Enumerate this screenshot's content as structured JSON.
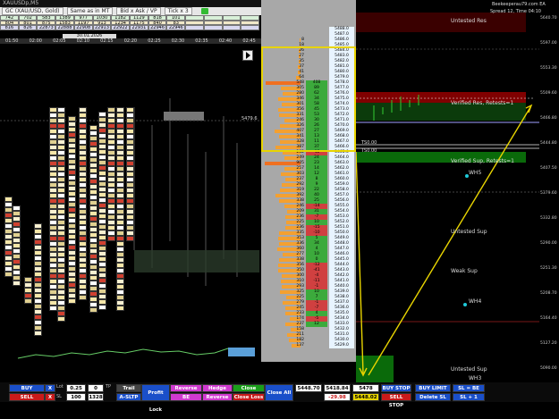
{
  "window": {
    "title": "XAUUSDp,M5",
    "top_right_title": "Beekeeperau79.com EA",
    "spread_label": "Spread 12, Time 04:10"
  },
  "toolbar": {
    "symbol": "GC (XAU/USD, Gold)",
    "mt_mode": "Same as in MT",
    "mode": "Bid x Ask / VP",
    "tick": "Tick x 3"
  },
  "stat_grid": [
    [
      "742",
      "702",
      "583",
      "1389",
      "977",
      "1030",
      "1182",
      "1129",
      "818",
      "101",
      "",
      "",
      "",
      ""
    ],
    [
      "804",
      "801",
      "875",
      "1583",
      "1197",
      "913",
      "1234",
      "1175",
      "840",
      "83",
      "",
      "",
      "",
      ""
    ],
    [
      "816",
      "826",
      "22873",
      "22888",
      "22908",
      "22913",
      "22922",
      "22931",
      "22946",
      "22946",
      "",
      "",
      "",
      ""
    ]
  ],
  "date_label": "30.01.2026",
  "time_row": [
    "01:50",
    "02:00",
    "02:05",
    "02:10",
    "02:15",
    "02:20",
    "02:25",
    "02:30",
    "02:35",
    "02:40",
    "02:45"
  ],
  "chart_price_marker": "5479.6",
  "volume_profile": [
    {
      "vol": "",
      "delta": "",
      "price": "5488.0"
    },
    {
      "vol": "",
      "delta": "",
      "price": "5487.0"
    },
    {
      "vol": "8",
      "delta": "",
      "price": "5486.0"
    },
    {
      "vol": "18",
      "delta": "",
      "price": "5485.0"
    },
    {
      "vol": "26",
      "delta": "",
      "price": "5484.0"
    },
    {
      "vol": "27",
      "delta": "",
      "price": "5483.0"
    },
    {
      "vol": "35",
      "delta": "",
      "price": "5482.0"
    },
    {
      "vol": "37",
      "delta": "",
      "price": "5481.0"
    },
    {
      "vol": "41",
      "delta": "",
      "price": "5480.0"
    },
    {
      "vol": "64",
      "delta": "",
      "price": "5479.0"
    },
    {
      "vol": "548",
      "delta": "408",
      "price": "5478.0"
    },
    {
      "vol": "305",
      "delta": "89",
      "price": "5477.0"
    },
    {
      "vol": "280",
      "delta": "62",
      "price": "5476.0"
    },
    {
      "vol": "346",
      "delta": "34",
      "price": "5475.0"
    },
    {
      "vol": "301",
      "delta": "58",
      "price": "5474.0"
    },
    {
      "vol": "356",
      "delta": "45",
      "price": "5473.0"
    },
    {
      "vol": "331",
      "delta": "53",
      "price": "5472.0"
    },
    {
      "vol": "246",
      "delta": "30",
      "price": "5471.0"
    },
    {
      "vol": "326",
      "delta": "26",
      "price": "5470.0"
    },
    {
      "vol": "407",
      "delta": "27",
      "price": "5469.0"
    },
    {
      "vol": "341",
      "delta": "13",
      "price": "5468.0"
    },
    {
      "vol": "328",
      "delta": "11",
      "price": "5467.0"
    },
    {
      "vol": "387",
      "delta": "37",
      "price": "5466.0"
    },
    {
      "vol": "282",
      "delta": "-12",
      "price": "5465.0"
    },
    {
      "vol": "249",
      "delta": "24",
      "price": "5464.0"
    },
    {
      "vol": "905",
      "delta": "23",
      "price": "5463.0"
    },
    {
      "vol": "257",
      "delta": "14",
      "price": "5462.0"
    },
    {
      "vol": "303",
      "delta": "12",
      "price": "5461.0"
    },
    {
      "vol": "237",
      "delta": "8",
      "price": "5460.0"
    },
    {
      "vol": "292",
      "delta": "9",
      "price": "5459.0"
    },
    {
      "vol": "319",
      "delta": "22",
      "price": "5458.0"
    },
    {
      "vol": "392",
      "delta": "40",
      "price": "5457.0"
    },
    {
      "vol": "338",
      "delta": "25",
      "price": "5456.0"
    },
    {
      "vol": "246",
      "delta": "-14",
      "price": "5455.0"
    },
    {
      "vol": "209",
      "delta": "31",
      "price": "5454.0"
    },
    {
      "vol": "236",
      "delta": "-7",
      "price": "5453.0"
    },
    {
      "vol": "225",
      "delta": "10",
      "price": "5452.0"
    },
    {
      "vol": "236",
      "delta": "-15",
      "price": "5451.0"
    },
    {
      "vol": "335",
      "delta": "-10",
      "price": "5450.0"
    },
    {
      "vol": "353",
      "delta": "5",
      "price": "5449.0"
    },
    {
      "vol": "336",
      "delta": "34",
      "price": "5448.0"
    },
    {
      "vol": "360",
      "delta": "4",
      "price": "5447.0"
    },
    {
      "vol": "277",
      "delta": "10",
      "price": "5446.0"
    },
    {
      "vol": "338",
      "delta": "0",
      "price": "5445.0"
    },
    {
      "vol": "356",
      "delta": "-12",
      "price": "5444.0"
    },
    {
      "vol": "350",
      "delta": "-41",
      "price": "5443.0"
    },
    {
      "vol": "300",
      "delta": "-4",
      "price": "5442.0"
    },
    {
      "vol": "310",
      "delta": "-11",
      "price": "5441.0"
    },
    {
      "vol": "293",
      "delta": "-1",
      "price": "5440.0"
    },
    {
      "vol": "325",
      "delta": "10",
      "price": "5439.0"
    },
    {
      "vol": "225",
      "delta": "7",
      "price": "5438.0"
    },
    {
      "vol": "279",
      "delta": "-1",
      "price": "5437.0"
    },
    {
      "vol": "245",
      "delta": "-7",
      "price": "5436.0"
    },
    {
      "vol": "233",
      "delta": "4",
      "price": "5435.0"
    },
    {
      "vol": "174",
      "delta": "-5",
      "price": "5434.0"
    },
    {
      "vol": "237",
      "delta": "12",
      "price": "5433.0"
    },
    {
      "vol": "158",
      "delta": "",
      "price": "5432.0"
    },
    {
      "vol": "211",
      "delta": "",
      "price": "5431.0"
    },
    {
      "vol": "182",
      "delta": "",
      "price": "5430.0"
    },
    {
      "vol": "137",
      "delta": "",
      "price": "5429.0"
    }
  ],
  "right_labels": {
    "untested_res": "Untested Res",
    "verified_res": "Verified Res, Retests=1",
    "verified_sup": "Verified Sup, Retests=1",
    "untested_sup": "Untested Sup",
    "weak_sup": "Weak Sup",
    "untested_sup2": "Untested Sup",
    "wh5": "WH5",
    "wh4": "WH4",
    "wh3": "WH3",
    "level_a": "TS0.00",
    "level_b": "TS0.00"
  },
  "price_axis": [
    "5640.70",
    "5597.00",
    "5553.30",
    "5509.60",
    "5466.80",
    "5444.80",
    "5407.50",
    "5379.60",
    "5332.80",
    "5290.00",
    "5251.30",
    "5208.70",
    "5164.40",
    "5127.20",
    "5090.00"
  ],
  "bottom_panel": {
    "buy": "BUY",
    "sell": "SELL",
    "x1": "X",
    "x2": "X",
    "lot_label": "Lot",
    "sl_label": "SL",
    "tp_label": "TP",
    "lot_value": "0.25",
    "zero_value": "0",
    "sl_value": "100",
    "tp_value": "1328",
    "trail": "Trail",
    "asltp": "A-SLTP",
    "profit_lock": "Profit Lock",
    "reverse": "Reverse",
    "be": "BE",
    "hedge": "Hedge",
    "reverse2": "Reverse",
    "close_profit": "Close Profit",
    "close_loss": "Close Loss",
    "close_all": "Close All",
    "price1": "5448.70",
    "price2": "5418.84",
    "price3": "-29.98",
    "price4": "5478",
    "price5": "5448.02",
    "buy_stop": "BUY STOP",
    "sell_stop": "SELL STOP",
    "buy_limit": "BUY LIMIT",
    "delete_sl": "Delete SL",
    "sl_be": "SL = BE",
    "sl_plus1": "SL + 1"
  }
}
